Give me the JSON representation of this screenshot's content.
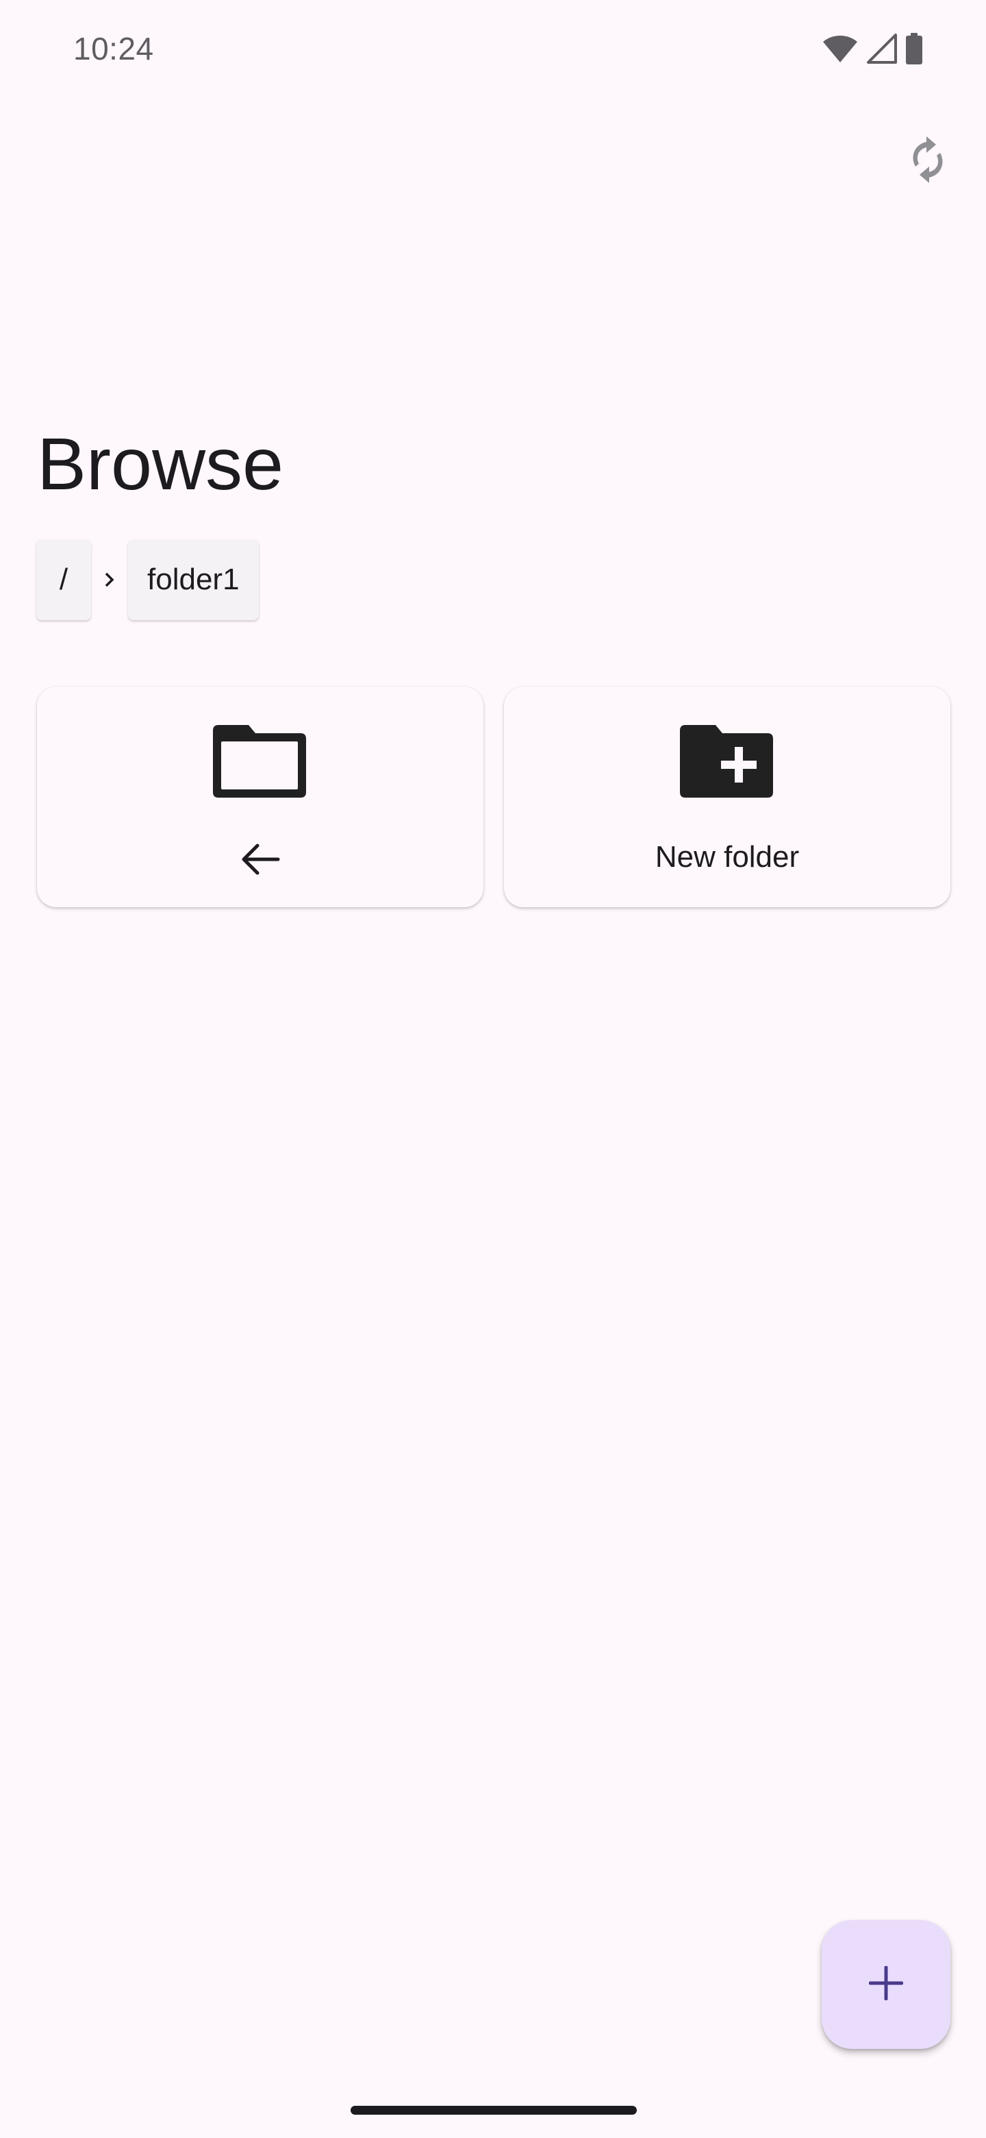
{
  "status_bar": {
    "time": "10:24",
    "icons": [
      "wifi-icon",
      "cellular-signal-icon",
      "battery-icon"
    ]
  },
  "toolbar": {
    "sync_icon": "sync-icon"
  },
  "page": {
    "title": "Browse"
  },
  "breadcrumb": {
    "root_label": "/",
    "separator_icon": "chevron-right-icon",
    "current_label": "folder1"
  },
  "grid": {
    "back_card": {
      "icon": "folder-outline-icon",
      "arrow_icon": "arrow-back-icon"
    },
    "new_folder_card": {
      "icon": "create-new-folder-icon",
      "label": "New folder"
    }
  },
  "fab": {
    "icon": "add-icon"
  },
  "colors": {
    "background": "#fef7fc",
    "fab_background": "#eaddfc",
    "fab_icon": "#4a3a8a",
    "text": "#1d1b20",
    "muted_icon": "#8f8f94"
  }
}
